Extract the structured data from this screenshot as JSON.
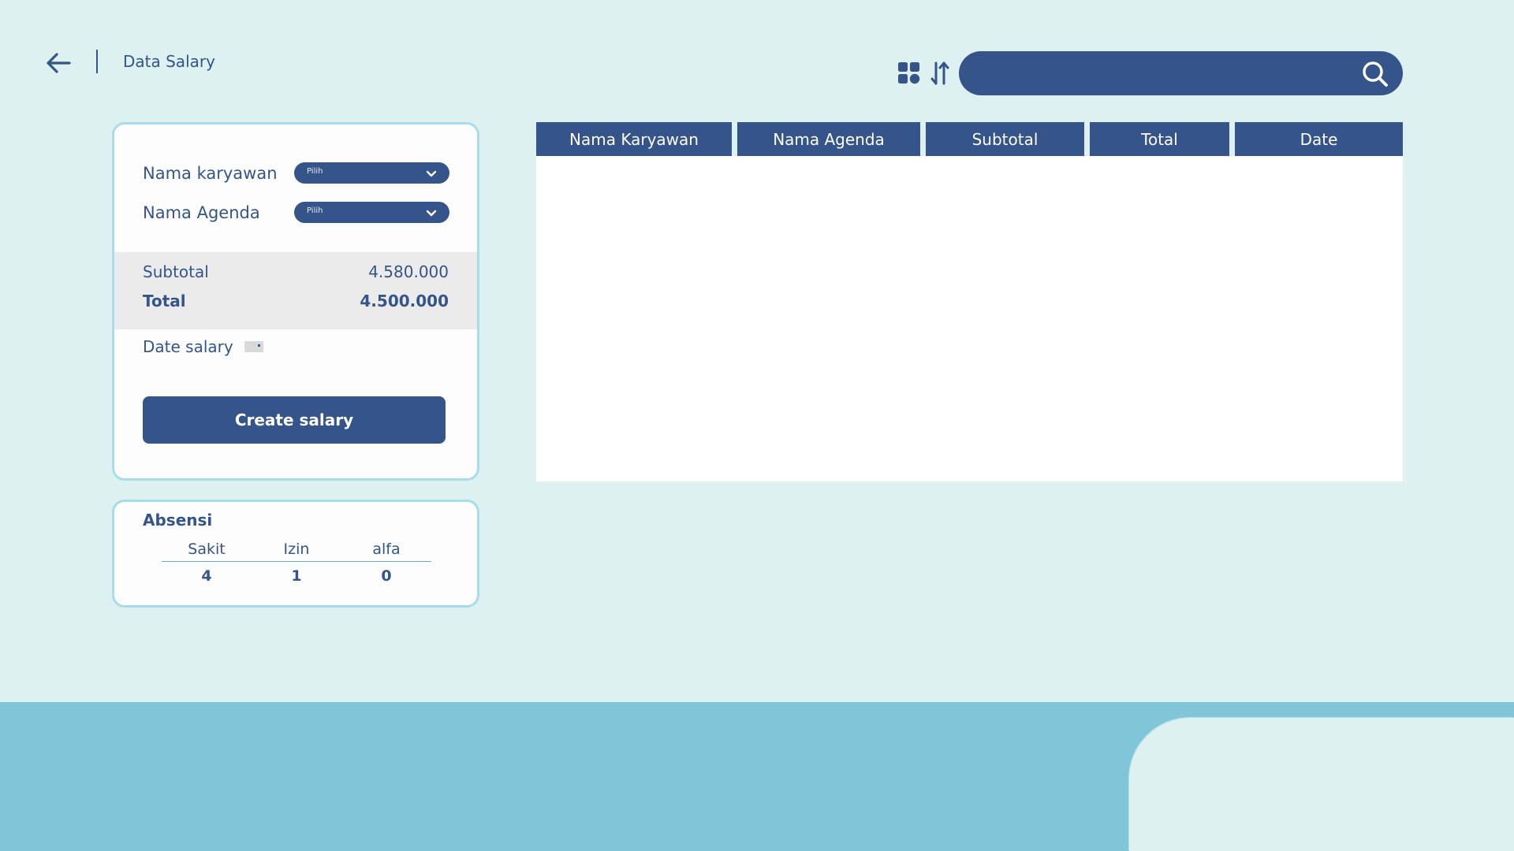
{
  "header": {
    "title": "Data Salary",
    "back_icon": "arrow-left-icon",
    "grid_icon": "grid-view-icon",
    "sort_icon": "sort-icon"
  },
  "search": {
    "value": "",
    "placeholder": "",
    "icon": "search-icon"
  },
  "form": {
    "employee_label": "Nama karyawan",
    "employee_select": "Pilih",
    "agenda_label": "Nama Agenda",
    "agenda_select": "Pilih",
    "subtotal_label": "Subtotal",
    "subtotal_value": "4.580.000",
    "total_label": "Total",
    "total_value": "4.500.000",
    "date_label": "Date salary",
    "create_button": "Create salary"
  },
  "absensi": {
    "title": "Absensi",
    "columns": [
      "Sakit",
      "Izin",
      "alfa"
    ],
    "values": [
      "4",
      "1",
      "0"
    ]
  },
  "table": {
    "columns": [
      "Nama Karyawan",
      "Nama Agenda",
      "Subtotal",
      "Total",
      "Date"
    ],
    "rows": []
  },
  "colors": {
    "primary": "#34548a",
    "background": "#dcf1f0",
    "accent": "#80c6d8",
    "card_border": "#a9dcea"
  }
}
